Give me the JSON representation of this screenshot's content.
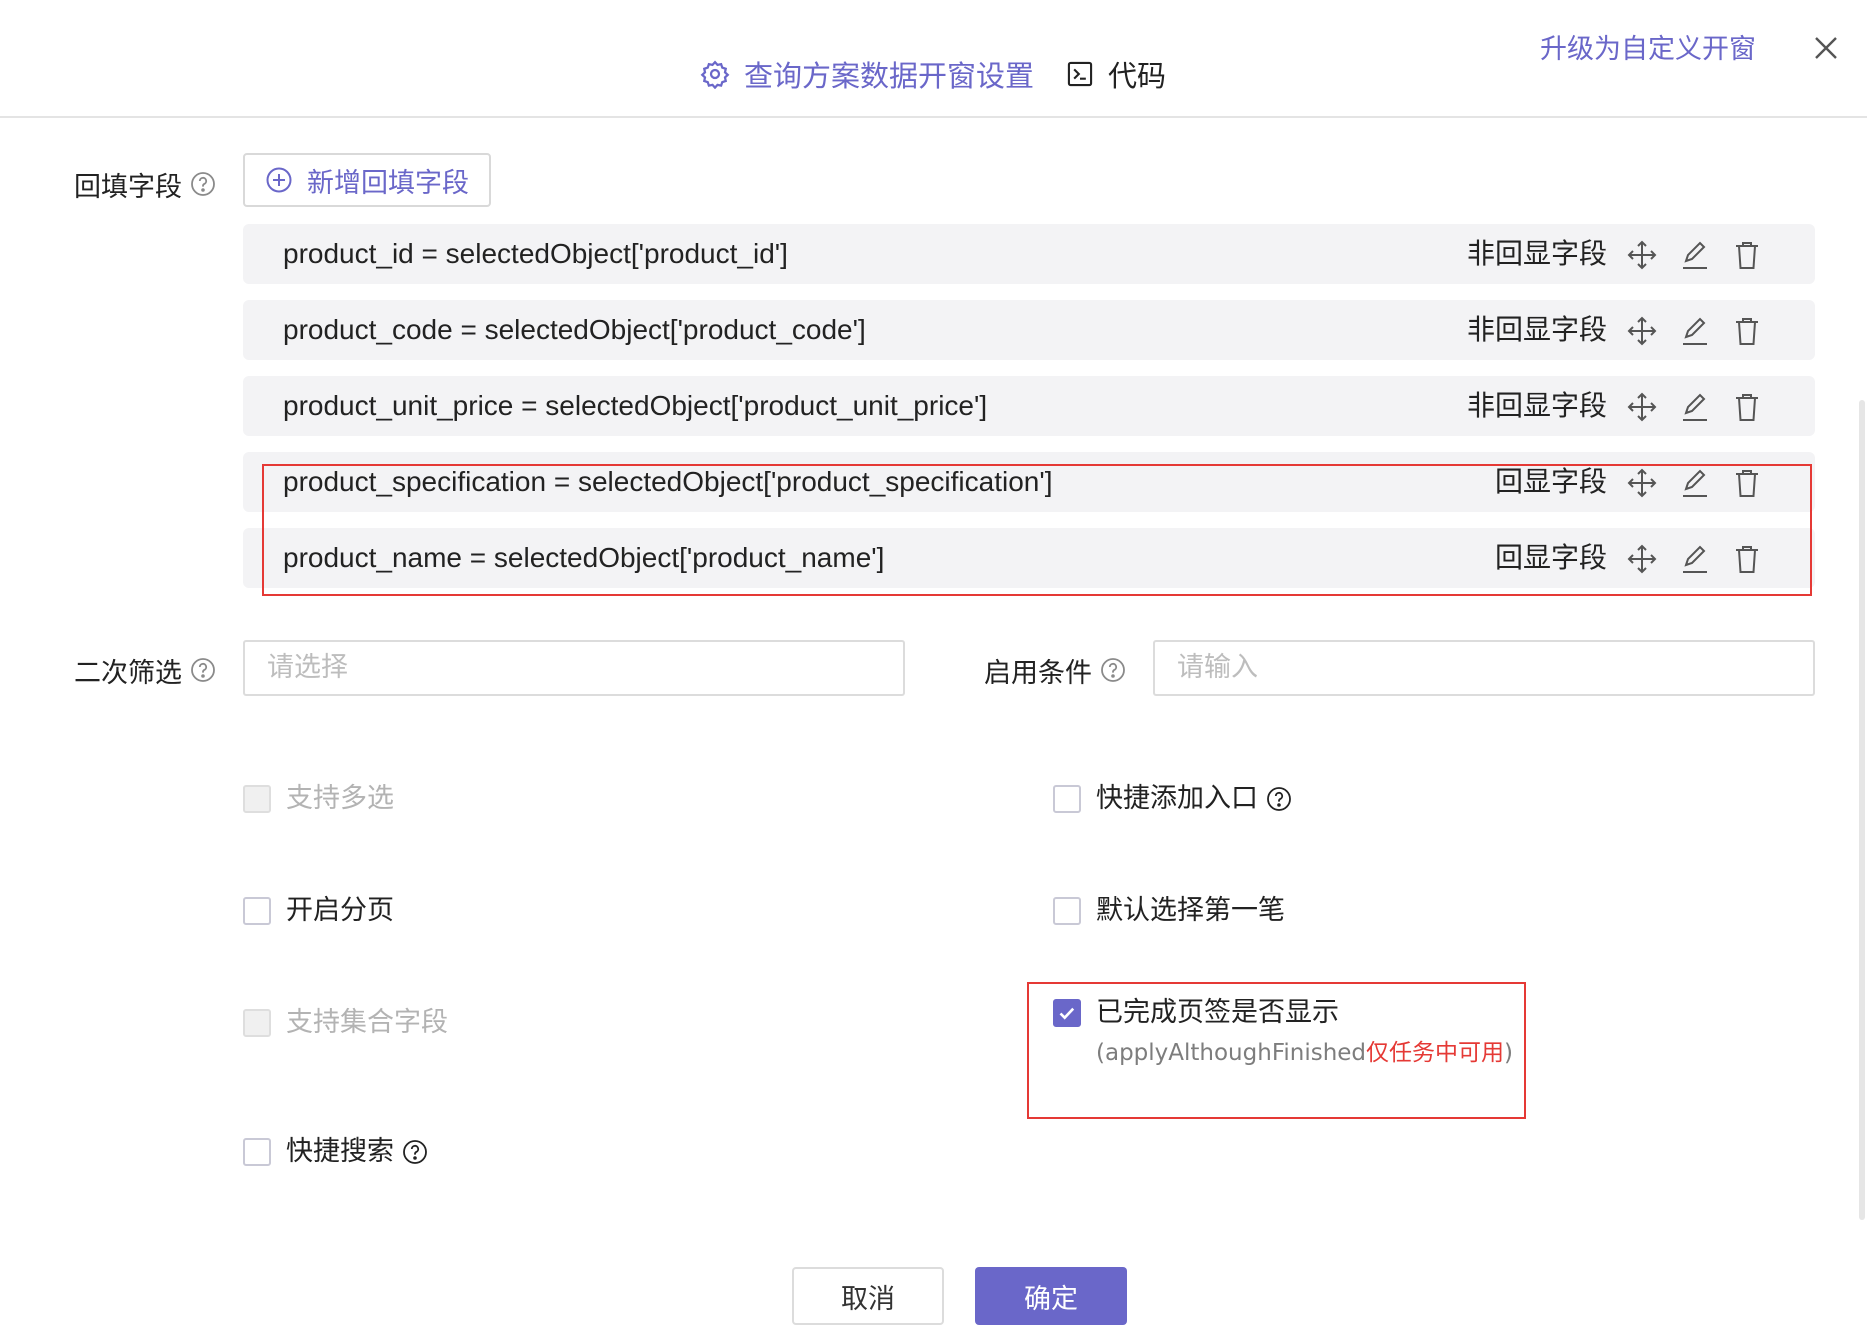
{
  "header": {
    "tab_settings_label": "查询方案数据开窗设置",
    "tab_code_label": "代码",
    "upgrade_link": "升级为自定义开窗",
    "accent_color": "#6a67c9"
  },
  "backfill": {
    "label": "回填字段",
    "add_button": "新增回填字段",
    "rows": [
      {
        "expr": "product_id = selectedObject['product_id']",
        "tag": "非回显字段"
      },
      {
        "expr": "product_code = selectedObject['product_code']",
        "tag": "非回显字段"
      },
      {
        "expr": "product_unit_price = selectedObject['product_unit_price']",
        "tag": "非回显字段"
      },
      {
        "expr": "product_specification = selectedObject['product_specification']",
        "tag": "回显字段"
      },
      {
        "expr": "product_name = selectedObject['product_name']",
        "tag": "回显字段"
      }
    ]
  },
  "secondary_filter": {
    "label": "二次筛选",
    "placeholder": "请选择"
  },
  "enable_condition": {
    "label": "启用条件",
    "placeholder": "请输入"
  },
  "options": {
    "multi_select": {
      "label": "支持多选",
      "checked": false,
      "disabled": true
    },
    "quick_add": {
      "label": "快捷添加入口",
      "checked": false
    },
    "paging": {
      "label": "开启分页",
      "checked": false
    },
    "default_first": {
      "label": "默认选择第一笔",
      "checked": false
    },
    "collection_field": {
      "label": "支持集合字段",
      "checked": false,
      "disabled": true
    },
    "finished_tab": {
      "label": "已完成页签是否显示",
      "checked": true,
      "sub_prefix": "(applyAlthoughFinished",
      "sub_red": "仅任务中可用",
      "sub_suffix": ")"
    },
    "quick_search": {
      "label": "快捷搜索",
      "checked": false
    }
  },
  "footer": {
    "cancel": "取消",
    "ok": "确定"
  },
  "colors": {
    "highlight_red": "#e53935",
    "row_bg": "#f3f3f5"
  }
}
